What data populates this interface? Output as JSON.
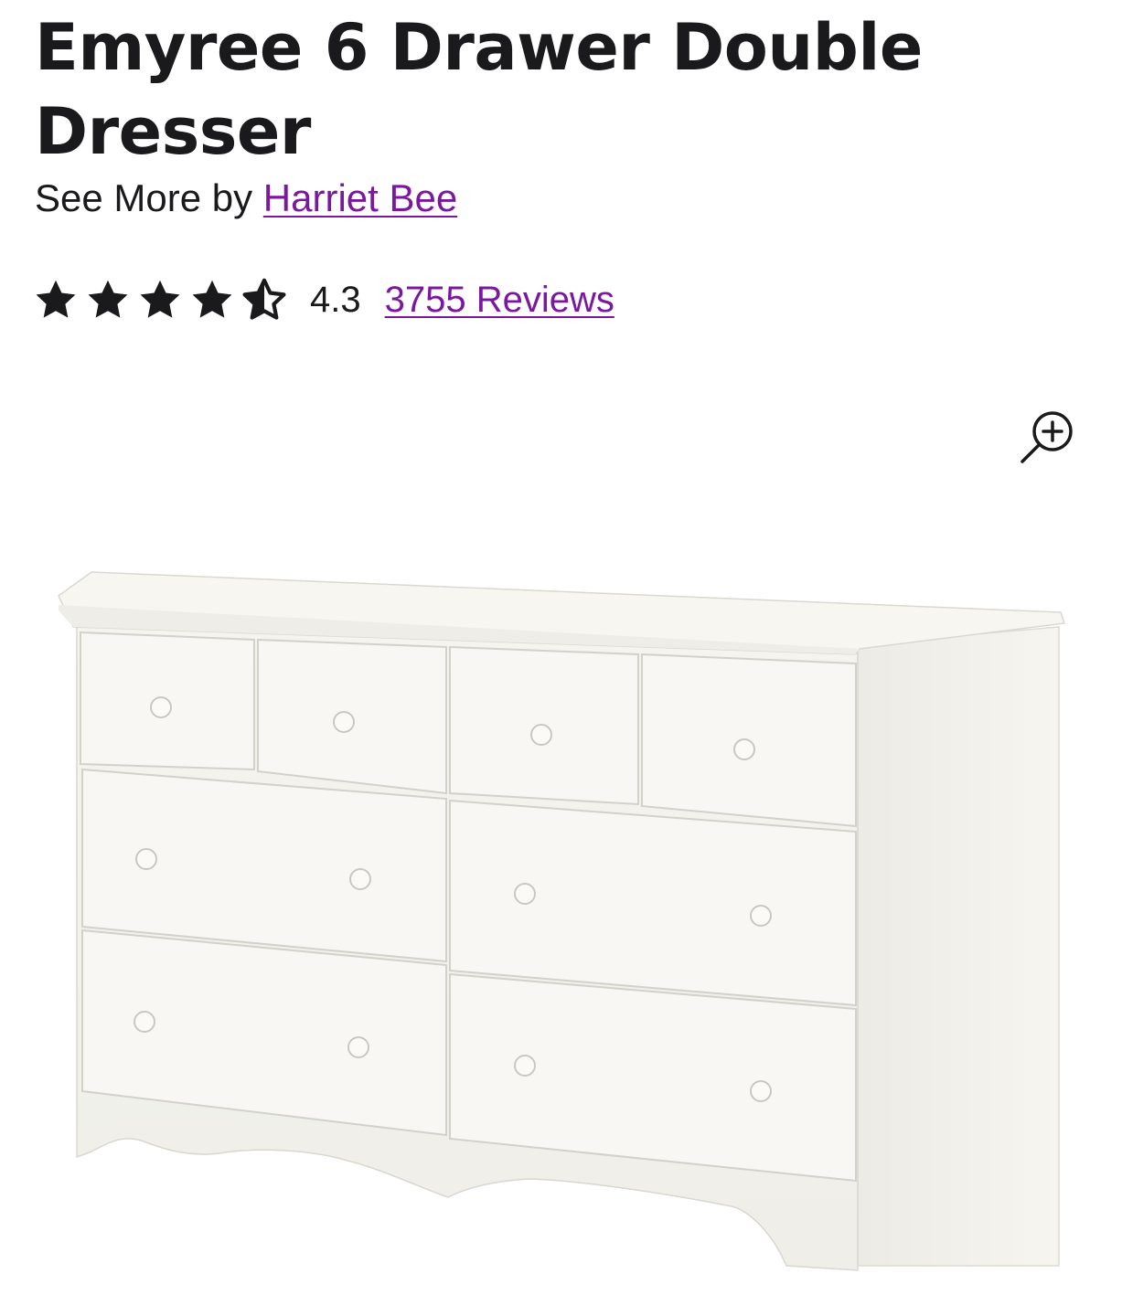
{
  "product": {
    "title": "Emyree 6 Drawer Double Dresser",
    "byline_prefix": "See More by",
    "brand": "Harriet Bee"
  },
  "rating": {
    "value": "4.3",
    "stars_filled": 4.3,
    "stars_max": 5,
    "reviews_label": "3755 Reviews"
  },
  "icons": {
    "star": "star-icon",
    "zoom": "zoom-in-icon"
  },
  "colors": {
    "text": "#1a1a1d",
    "link": "#7b189f",
    "star": "#1a1a1d",
    "dresser": "#f4f2ec"
  }
}
